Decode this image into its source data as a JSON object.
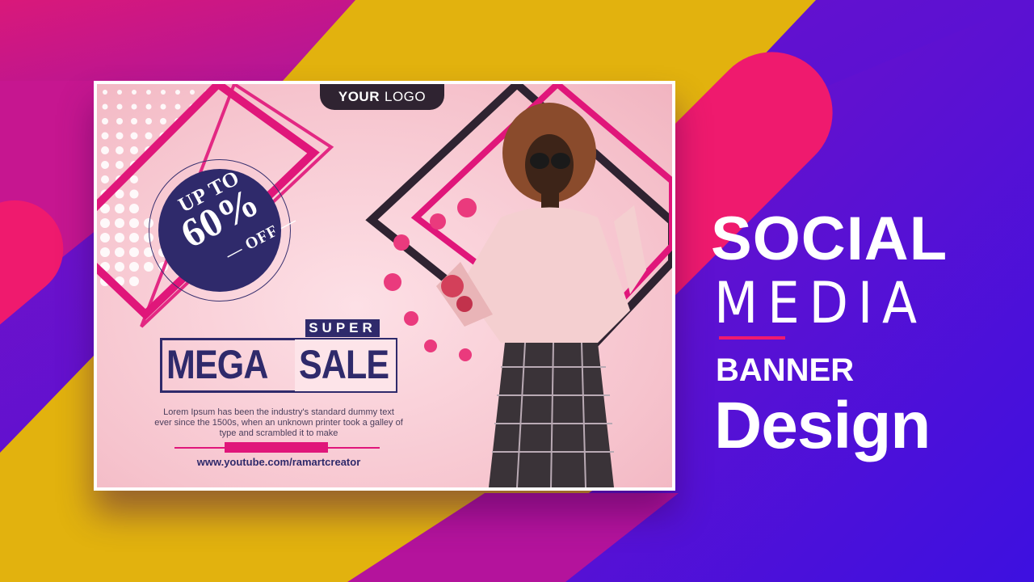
{
  "logo": {
    "bold": "YOUR",
    "light": "LOGO"
  },
  "offer": {
    "upto": "UP TO",
    "percent": "60%",
    "off": "— OFF —"
  },
  "sale": {
    "super": "SUPER",
    "mega": "MEGA",
    "sale": "SALE",
    "description": "Lorem Ipsum has been the industry's standard dummy text ever since the 1500s, when an unknown printer took a galley of type and scrambled it to make",
    "url": "www.youtube.com/ramartcreator"
  },
  "headline": {
    "line1": "SOCIAL",
    "line2": "MEDIA",
    "line3": "BANNER",
    "line4": "Design"
  },
  "colors": {
    "magenta": "#e0167a",
    "yellow": "#e2b20e",
    "purple": "#6a0fd0",
    "navy": "#2f2a6b",
    "pink_bg": "#f6c3cd",
    "dark": "#2f2331"
  },
  "model_photo": "fashion-model-photo"
}
